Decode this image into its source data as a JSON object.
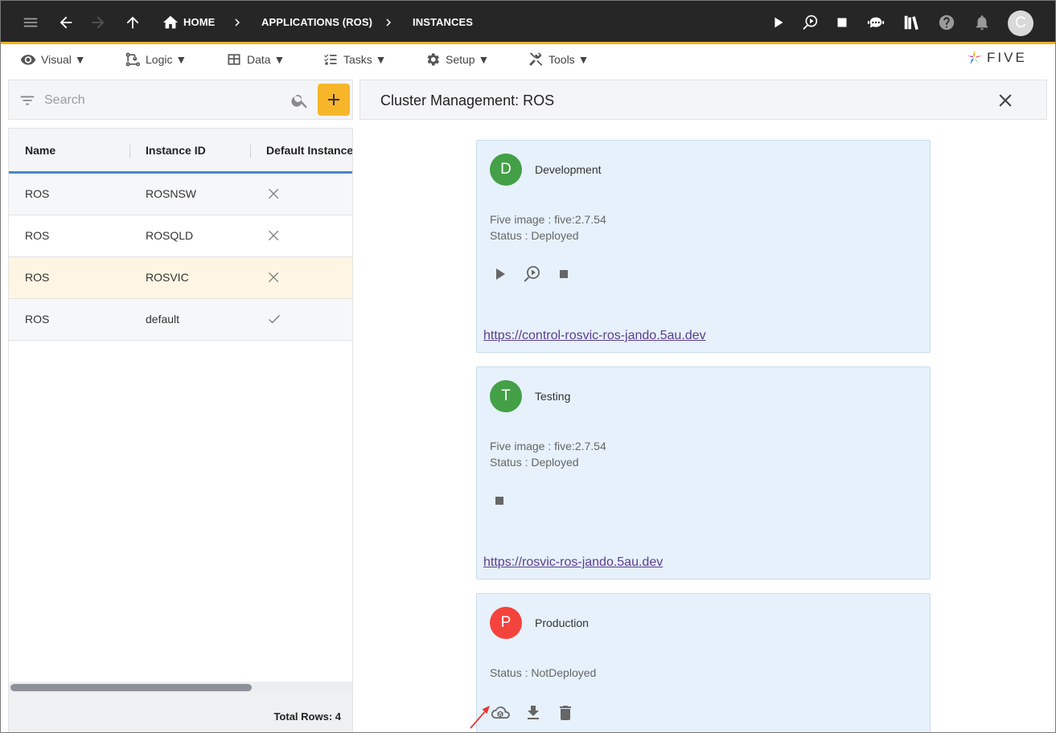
{
  "colors": {
    "topbar_bg": "#262626",
    "accent": "#f6b01e",
    "add_button": "#f7b52a",
    "header_underline": "#4a86c6",
    "selected_row": "#fff5e3",
    "card_bg": "#e6f1fb",
    "avatar_development": "#43a047",
    "avatar_testing": "#43a047",
    "avatar_production": "#f4433c",
    "link": "#5b3d8f",
    "annotation_arrow": "#e53935"
  },
  "topbar": {
    "icons": [
      "menu-icon",
      "back-arrow-icon",
      "forward-arrow-icon",
      "up-arrow-icon",
      "home-icon",
      "play-icon",
      "debug-run-icon",
      "stop-icon",
      "chat-bot-icon",
      "library-icon",
      "help-icon",
      "bell-icon"
    ],
    "breadcrumbs": [
      "HOME",
      "APPLICATIONS (ROS)",
      "INSTANCES"
    ],
    "user_initial": "C"
  },
  "menubar": {
    "items": [
      {
        "label": "Visual ▼",
        "icon": "eye-icon"
      },
      {
        "label": "Logic ▼",
        "icon": "logic-flow-icon"
      },
      {
        "label": "Data ▼",
        "icon": "table-icon"
      },
      {
        "label": "Tasks ▼",
        "icon": "checklist-icon"
      },
      {
        "label": "Setup ▼",
        "icon": "gear-icon"
      },
      {
        "label": "Tools ▼",
        "icon": "tools-icon"
      }
    ],
    "logo_text": "FIVE"
  },
  "search": {
    "placeholder": "Search"
  },
  "grid": {
    "columns": [
      "Name",
      "Instance ID",
      "Default Instance"
    ],
    "rows": [
      {
        "name": "ROS",
        "instance_id": "ROSNSW",
        "default": "false"
      },
      {
        "name": "ROS",
        "instance_id": "ROSQLD",
        "default": "false"
      },
      {
        "name": "ROS",
        "instance_id": "ROSVIC",
        "default": "false"
      },
      {
        "name": "ROS",
        "instance_id": "default",
        "default": "true"
      }
    ],
    "selected_row": 2,
    "footer": "Total Rows: 4"
  },
  "panel": {
    "title": "Cluster Management: ROS"
  },
  "clusters": [
    {
      "initial": "D",
      "name": "Development",
      "image": "Five image : five:2.7.54",
      "status": "Status : Deployed",
      "actions": [
        "play-icon",
        "debug-run-icon",
        "stop-icon"
      ],
      "link": "https://control-rosvic-ros-jando.5au.dev"
    },
    {
      "initial": "T",
      "name": "Testing",
      "image": "Five image : five:2.7.54",
      "status": "Status : Deployed",
      "actions": [
        "stop-icon"
      ],
      "link": "https://rosvic-ros-jando.5au.dev"
    },
    {
      "initial": "P",
      "name": "Production",
      "status": "Status : NotDeployed",
      "actions": [
        "cloud-deploy-icon",
        "download-icon",
        "delete-icon"
      ]
    }
  ]
}
